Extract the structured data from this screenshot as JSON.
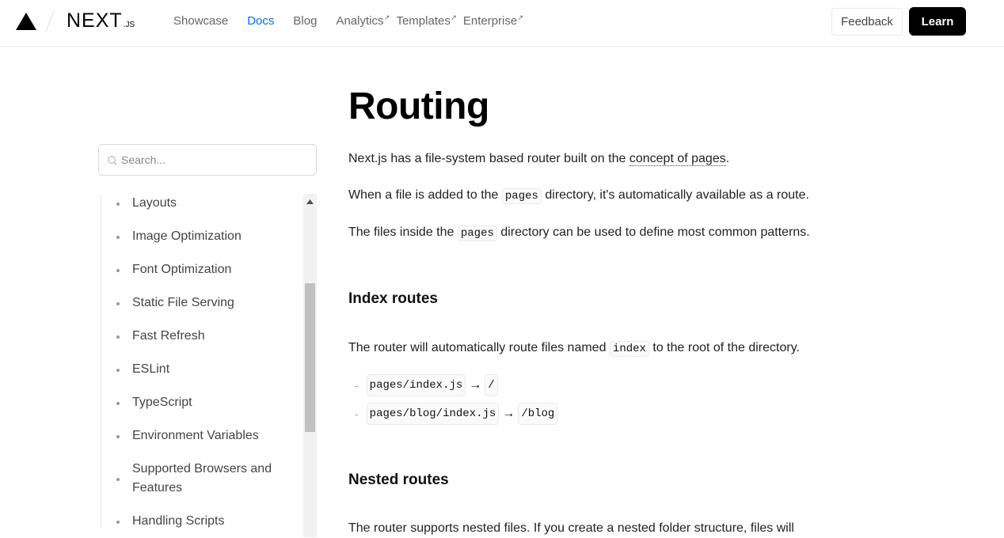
{
  "header": {
    "brand": "NEXT",
    "brand_suffix": ".JS",
    "nav": [
      {
        "label": "Showcase"
      },
      {
        "label": "Docs"
      },
      {
        "label": "Blog"
      },
      {
        "label": "Analytics"
      },
      {
        "label": "Templates"
      },
      {
        "label": "Enterprise"
      }
    ],
    "external_arrow": "↗",
    "feedback_label": "Feedback",
    "learn_label": "Learn"
  },
  "sidebar": {
    "search_placeholder": "Search...",
    "items": [
      {
        "label": "Layouts"
      },
      {
        "label": "Image Optimization"
      },
      {
        "label": "Font Optimization"
      },
      {
        "label": "Static File Serving"
      },
      {
        "label": "Fast Refresh"
      },
      {
        "label": "ESLint"
      },
      {
        "label": "TypeScript"
      },
      {
        "label": "Environment Variables"
      },
      {
        "label": "Supported Browsers and Features"
      },
      {
        "label": "Handling Scripts"
      }
    ]
  },
  "main": {
    "title": "Routing",
    "intro": {
      "before": "Next.js has a file-system based router built on the ",
      "link": "concept of pages",
      "after": "."
    },
    "p2": {
      "before": "When a file is added to the ",
      "code": "pages",
      "after": " directory, it's automatically available as a route."
    },
    "p3": {
      "before": "The files inside the ",
      "code": "pages",
      "after": " directory can be used to define most common patterns."
    },
    "index_routes": {
      "heading": "Index routes",
      "text_before": "The router will automatically route files named ",
      "code": "index",
      "text_after": " to the root of the directory.",
      "routes": [
        {
          "file": "pages/index.js",
          "route": "/"
        },
        {
          "file": "pages/blog/index.js",
          "route": "/blog"
        }
      ],
      "dash": "-",
      "arrow": "→"
    },
    "nested_routes": {
      "heading": "Nested routes",
      "text": "The router supports nested files. If you create a nested folder structure, files will"
    }
  },
  "colors": {
    "accent": "#0070f3",
    "text": "#111111",
    "muted": "#666666",
    "border": "#eaeaea"
  }
}
